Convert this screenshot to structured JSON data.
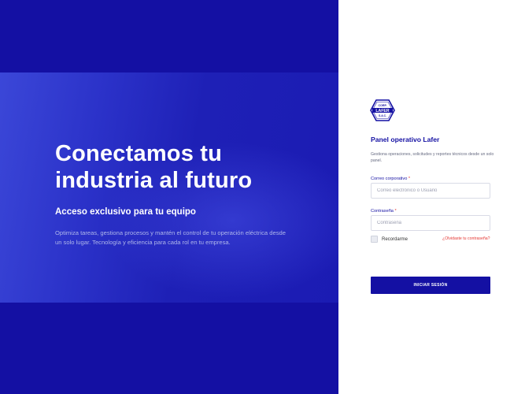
{
  "hero": {
    "title": "Conectamos tu industria al futuro",
    "subtitle": "Acceso exclusivo para tu equipo",
    "description": "Optimiza tareas, gestiona procesos y mantén el control de tu operación eléctrica desde un solo lugar. Tecnología y eficiencia para cada rol en tu empresa."
  },
  "logo": {
    "top_text": "CORP.",
    "brand": "LAFER",
    "bottom_text": "S.A.C."
  },
  "panel": {
    "title": "Panel operativo Lafer",
    "description": "Gestiona operaciones, solicitudes y reportes técnicos desde un solo panel."
  },
  "form": {
    "email_label": "Correo corporativo",
    "email_placeholder": "Correo electrónico o Usuario",
    "password_label": "Contraseña",
    "password_placeholder": "Contraseña",
    "required_mark": "*",
    "remember_label": "Recordarme",
    "forgot_label": "¿Olvidaste tu contraseña?",
    "submit_label": "INICIAR SESIÓN"
  },
  "colors": {
    "brand": "#1410a3",
    "accent_red": "#e53935"
  }
}
